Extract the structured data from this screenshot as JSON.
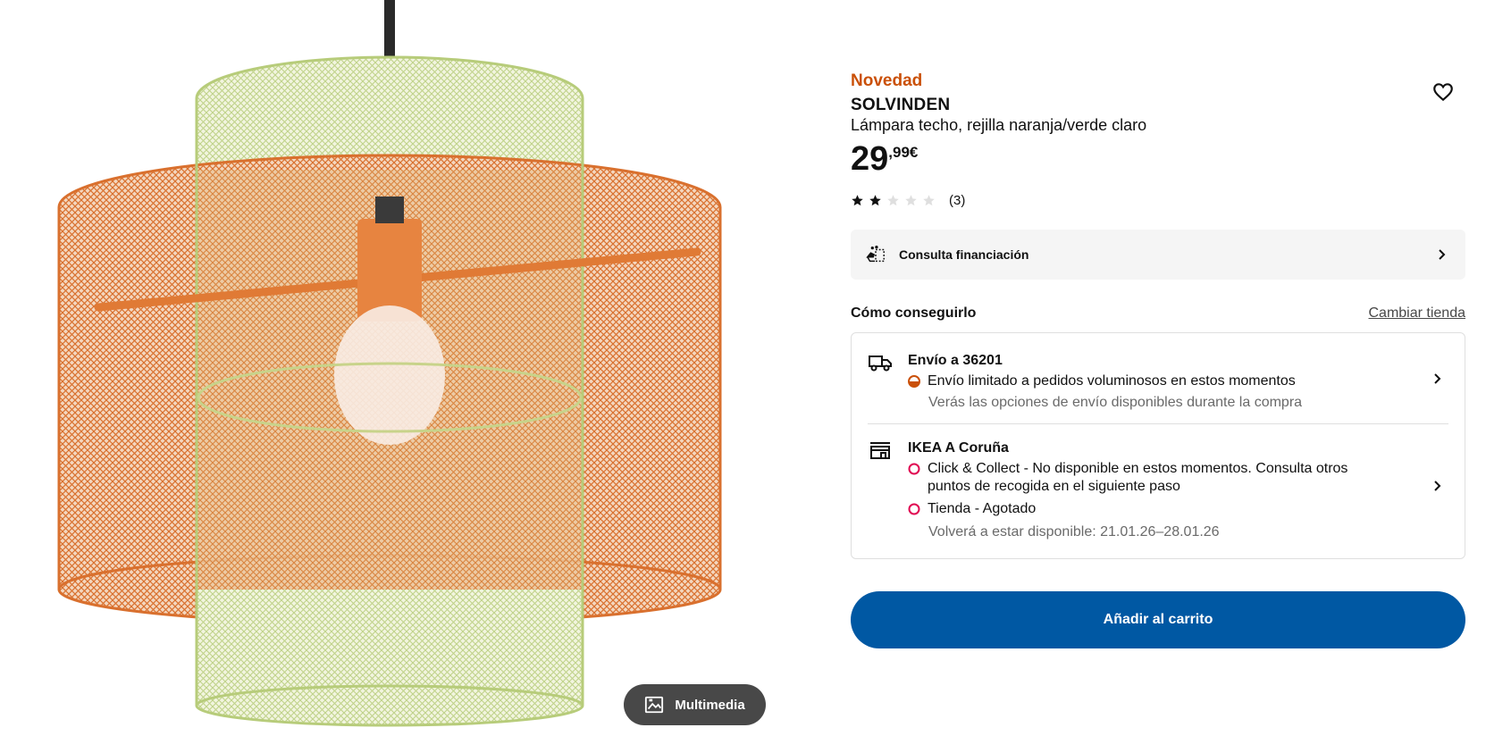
{
  "product": {
    "badge": "Novedad",
    "name": "SOLVINDEN",
    "description": "Lámpara techo, rejilla naranja/verde claro",
    "price_integer": "29",
    "price_decimal": ",99€",
    "rating_value": 2,
    "rating_max": 5,
    "rating_count": "(3)"
  },
  "media": {
    "multimedia_label": "Multimedia"
  },
  "financing": {
    "label": "Consulta financiación"
  },
  "fulfillment": {
    "title": "Cómo conseguirlo",
    "change_store_label": "Cambiar tienda",
    "delivery": {
      "title": "Envío a 36201",
      "status": "Envío limitado a pedidos voluminosos en estos momentos",
      "note": "Verás las opciones de envío disponibles durante la compra"
    },
    "store": {
      "title": "IKEA A Coruña",
      "click_collect_line1": "Click & Collect - No disponible en estos momentos. Consulta otros",
      "click_collect_line2": "puntos de recogida en el siguiente paso",
      "store_status": "Tienda - Agotado",
      "restock": "Volverá a estar disponible: 21.01.26–28.01.26"
    }
  },
  "cart": {
    "add_label": "Añadir al carrito"
  },
  "colors": {
    "accent_orange": "#ca5008",
    "primary_blue": "#0058a3",
    "status_partial": "#ca5008",
    "status_unavailable": "#e00751"
  }
}
